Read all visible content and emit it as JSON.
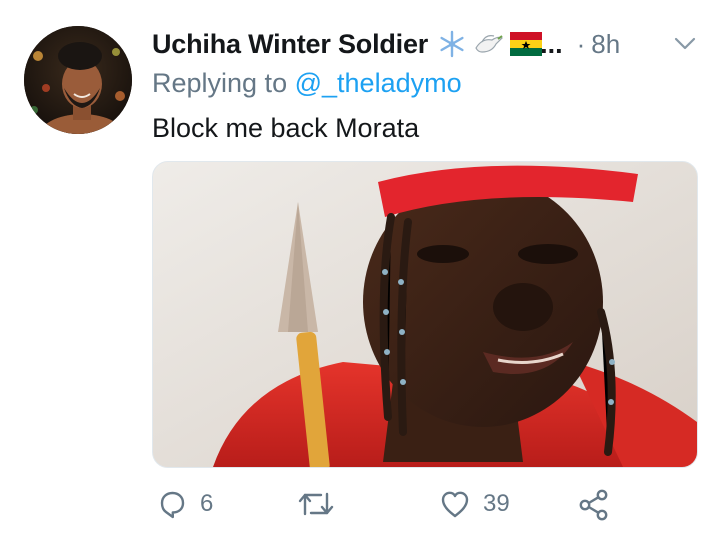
{
  "tweet": {
    "author_name": "Uchiha Winter Soldier",
    "name_truncation": "...",
    "separator": "·",
    "time": "8h",
    "replying_prefix": "Replying to",
    "reply_handle": "@_theladymo",
    "text": "Block me back Morata"
  },
  "actions": {
    "reply_count": "6",
    "retweet_count": "",
    "like_count": "39"
  },
  "colors": {
    "link": "#1da1f2",
    "muted": "#657786",
    "text": "#14171a"
  },
  "icons": [
    "snowflake-emoji-icon",
    "dove-emoji-icon",
    "ghana-flag-emoji-icon",
    "chevron-down-icon",
    "reply-icon",
    "retweet-icon",
    "like-icon",
    "share-icon"
  ]
}
